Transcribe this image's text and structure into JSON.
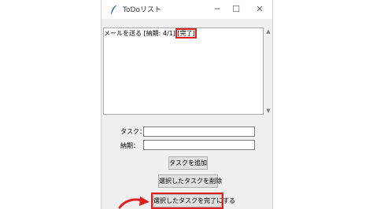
{
  "window": {
    "title": "ToDoリスト",
    "minimize_symbol": "─",
    "maximize_symbol": "☐",
    "close_symbol": "✕"
  },
  "listbox": {
    "items": [
      {
        "text": "メールを送る [納期: 4/1] ",
        "status": "[完了]"
      }
    ],
    "scroll_up_symbol": "▲",
    "scroll_down_symbol": "▼"
  },
  "form": {
    "task_label": "タスク：",
    "task_value": "",
    "due_label": "納期：",
    "due_value": ""
  },
  "buttons": {
    "add": "タスクを追加",
    "delete": "選択したタスクを削除",
    "complete": "選択したタスクを完了にする"
  },
  "colors": {
    "highlight": "#e02020",
    "window_bg": "#f0f0f0"
  }
}
